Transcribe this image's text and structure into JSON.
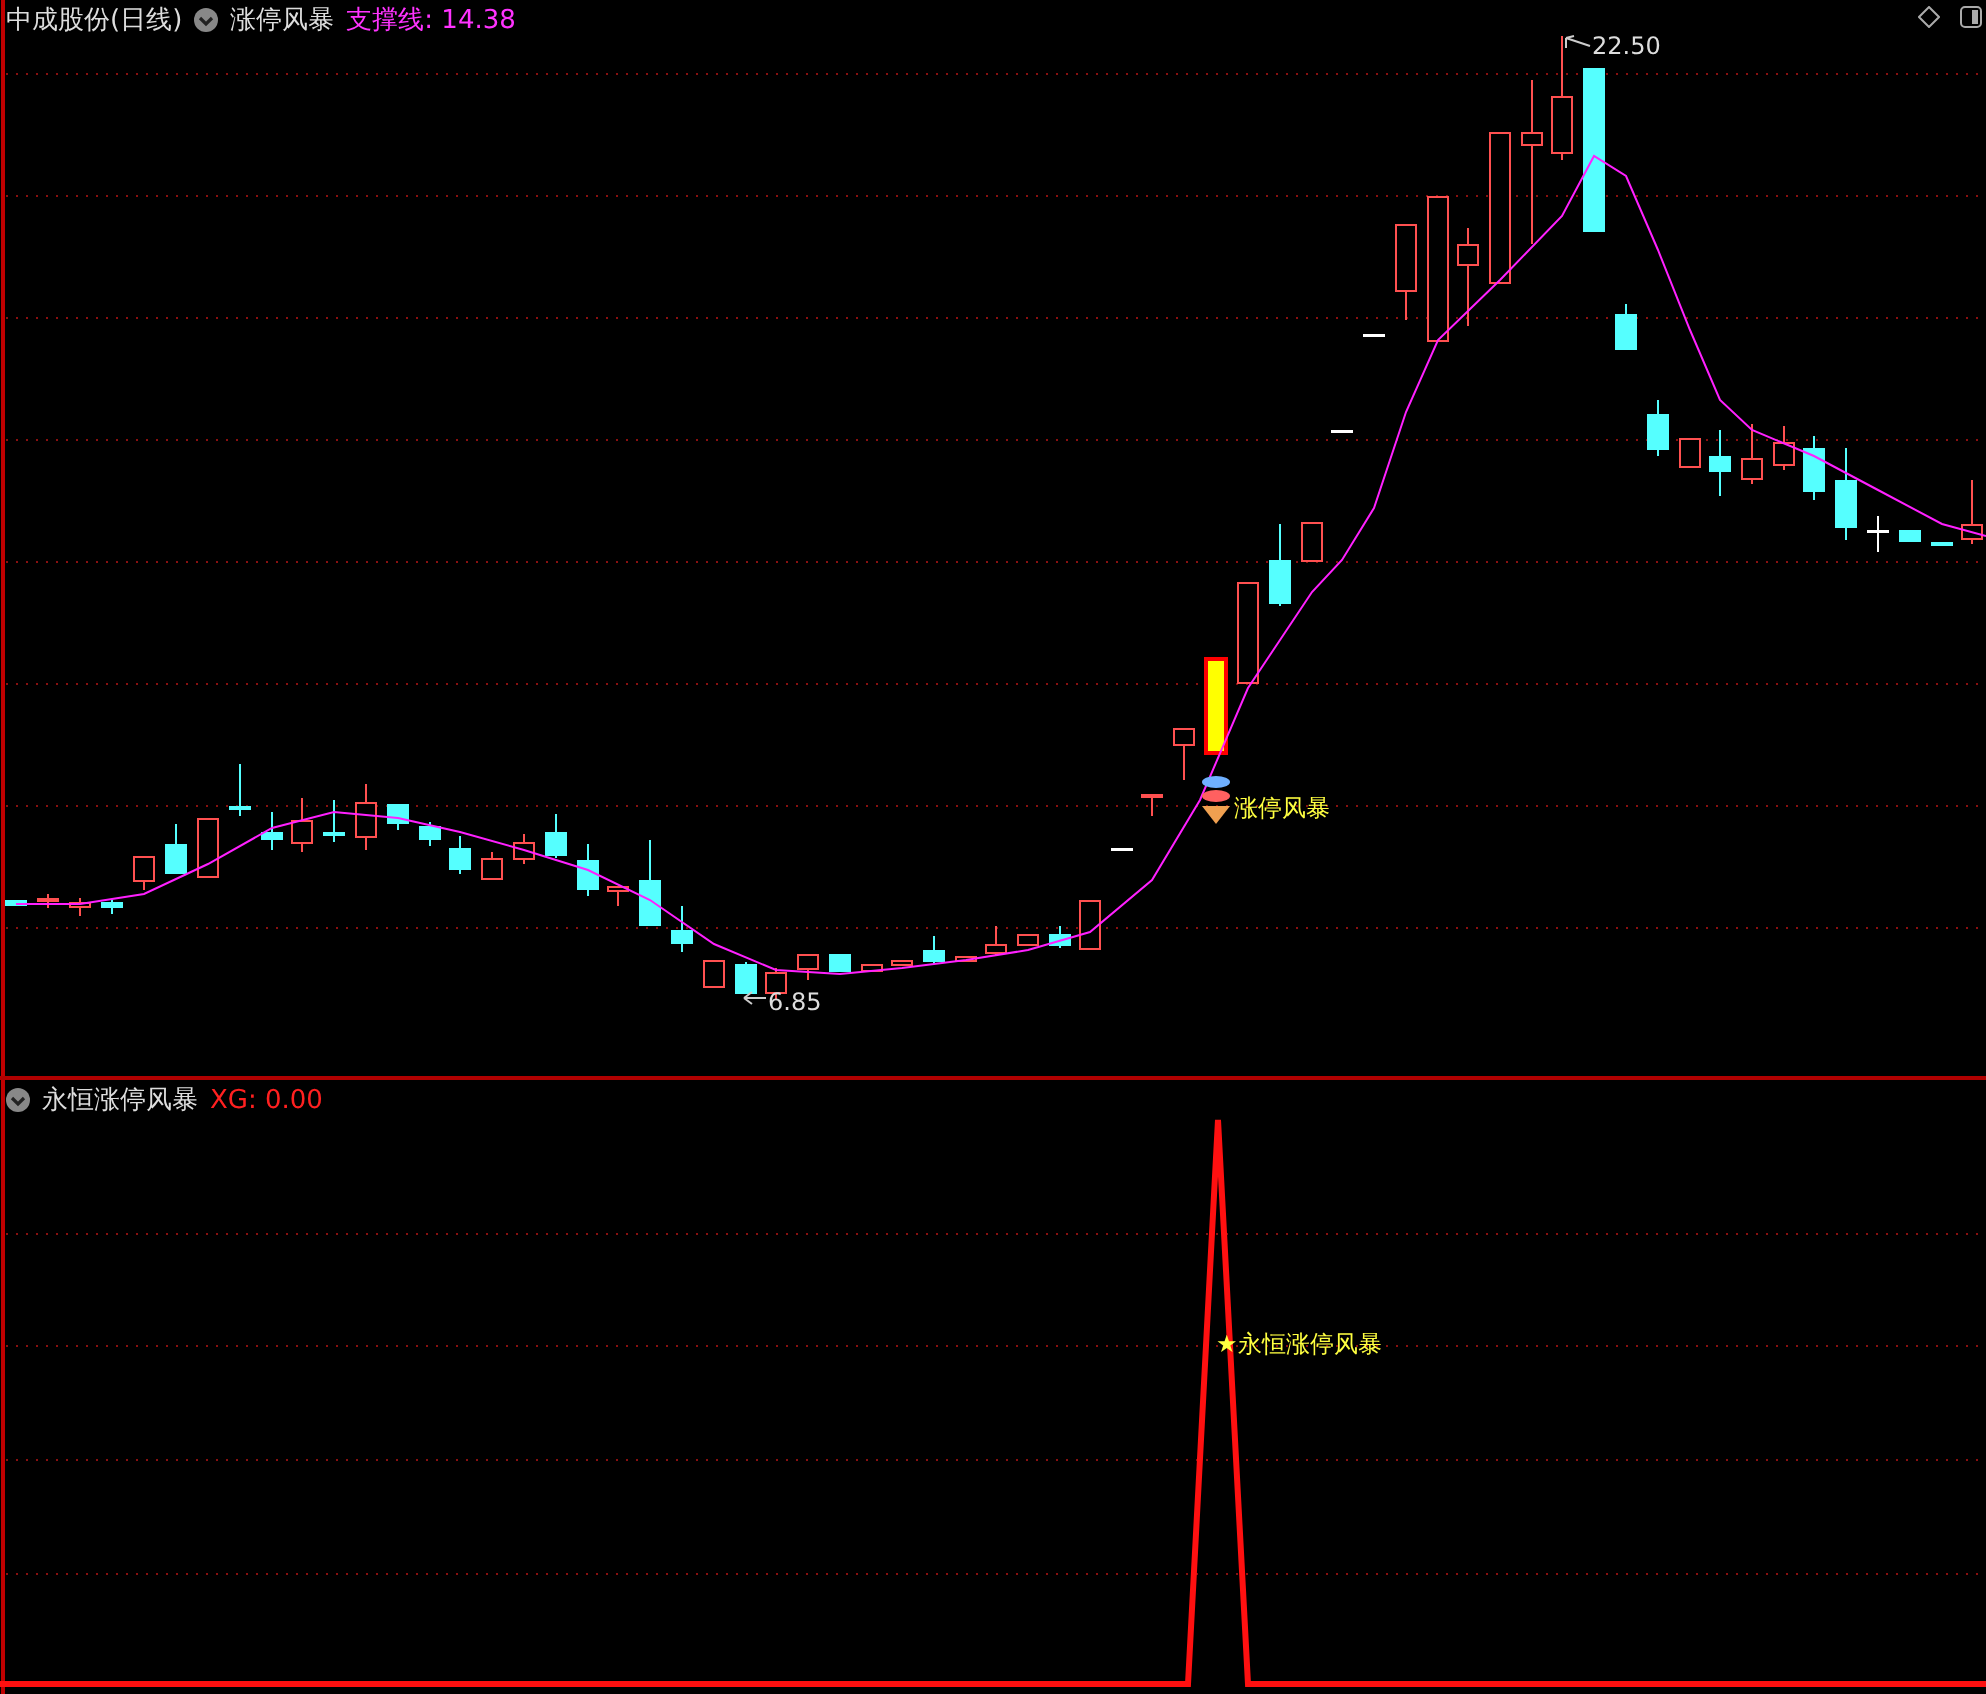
{
  "price_panel": {
    "title": "中成股份(日线)",
    "indicator": "涨停风暴",
    "support_reading": "支撑线: 14.38",
    "high_label": "22.50",
    "low_label": "6.85",
    "signal_label": "涨停风暴"
  },
  "signal_panel": {
    "title": "永恒涨停风暴",
    "reading": "XG: 0.00",
    "signal_label": "★永恒涨停风暴"
  }
}
